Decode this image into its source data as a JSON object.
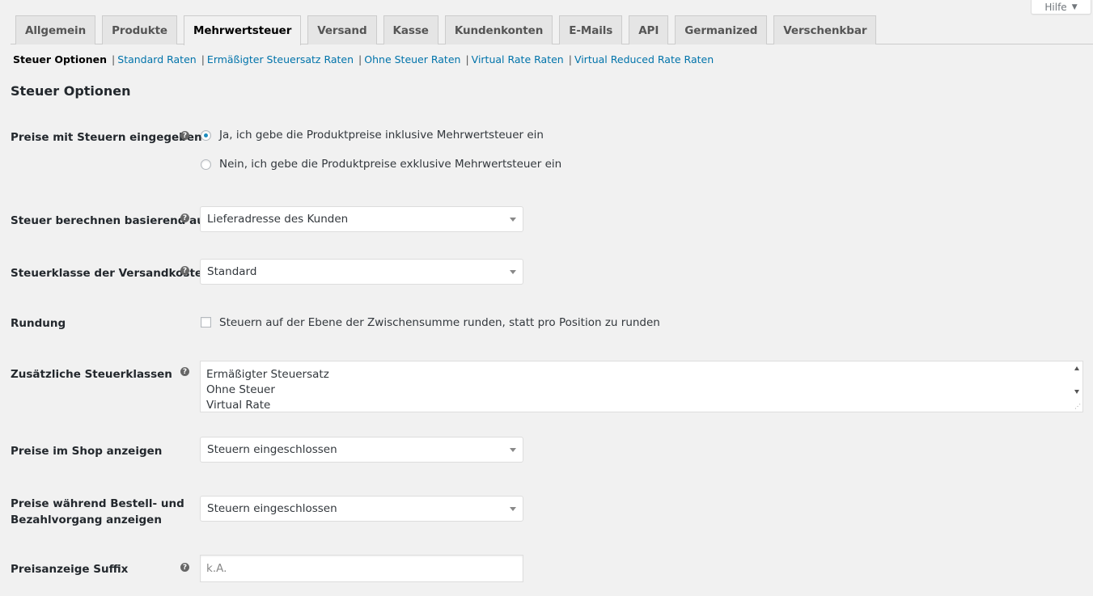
{
  "help": {
    "label": "Hilfe"
  },
  "tabs": [
    {
      "label": "Allgemein"
    },
    {
      "label": "Produkte"
    },
    {
      "label": "Mehrwertsteuer"
    },
    {
      "label": "Versand"
    },
    {
      "label": "Kasse"
    },
    {
      "label": "Kundenkonten"
    },
    {
      "label": "E-Mails"
    },
    {
      "label": "API"
    },
    {
      "label": "Germanized"
    },
    {
      "label": "Verschenkbar"
    }
  ],
  "active_tab": "Mehrwertsteuer",
  "subnav": {
    "current": "Steuer Optionen",
    "links": [
      "Standard Raten",
      "Ermäßigter Steuersatz Raten",
      "Ohne Steuer Raten",
      "Virtual Rate Raten",
      "Virtual Reduced Rate Raten"
    ],
    "separator": "|"
  },
  "section_title": "Steuer Optionen",
  "fields": {
    "prices_entered": {
      "label": "Preise mit Steuern eingegeben",
      "options": [
        "Ja, ich gebe die Produktpreise inklusive Mehrwertsteuer ein",
        "Nein, ich gebe die Produktpreise exklusive Mehrwertsteuer ein"
      ],
      "selected_index": 0
    },
    "tax_based_on": {
      "label": "Steuer berechnen basierend auf",
      "value": "Lieferadresse des Kunden"
    },
    "shipping_tax_class": {
      "label": "Steuerklasse der Versandkosten",
      "value": "Standard"
    },
    "rounding": {
      "label": "Rundung",
      "checkbox_label": "Steuern auf der Ebene der Zwischensumme runden, statt pro Position zu runden",
      "checked": false
    },
    "additional_tax_classes": {
      "label": "Zusätzliche Steuerklassen",
      "lines": [
        "Ermäßigter Steuersatz",
        "Ohne Steuer",
        "Virtual Rate"
      ]
    },
    "display_prices_shop": {
      "label": "Preise im Shop anzeigen",
      "value": "Steuern eingeschlossen"
    },
    "display_prices_cart": {
      "label_line1": "Preise während Bestell- und",
      "label_line2": "Bezahlvorgang anzeigen",
      "value": "Steuern eingeschlossen"
    },
    "price_suffix": {
      "label": "Preisanzeige Suffix",
      "placeholder": "k.A.",
      "value": ""
    }
  },
  "icons": {
    "help_tip": "question-circle-icon",
    "help_tip_glyph": "?"
  },
  "colors": {
    "link": "#0073aa",
    "radio_checked": "#1e8cbe",
    "background": "#f1f1f1"
  }
}
